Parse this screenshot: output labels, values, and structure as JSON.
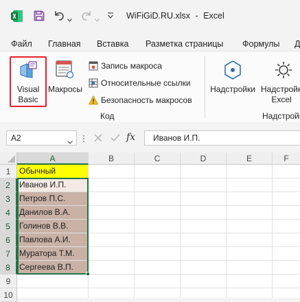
{
  "titlebar": {
    "file_name": "WiFiGiD.RU.xlsx",
    "separator": "-",
    "app_name": "Excel",
    "colors": {
      "excel_green": "#107c41",
      "save_purple": "#7b3fa0"
    }
  },
  "menu": {
    "items": [
      "Файл",
      "Главная",
      "Вставка",
      "Разметка страницы",
      "Формулы",
      "Д"
    ]
  },
  "ribbon": {
    "visual_basic_line1": "Visual",
    "visual_basic_line2": "Basic",
    "macros": "Макросы",
    "record_macro": "Запись макроса",
    "relative_refs": "Относительные ссылки",
    "macro_security": "Безопасность макросов",
    "group_code": "Код",
    "addins": "Надстройки",
    "excel_addins_line1": "Надстройки",
    "excel_addins_line2": "Excel",
    "group_addins": "Надстройки",
    "highlight_color": "#e8202a"
  },
  "formula_bar": {
    "name_box": "A2",
    "fx": "fx",
    "content": "Иванов И.П."
  },
  "sheet": {
    "columns": [
      "A",
      "B",
      "C",
      "D",
      "E",
      "F"
    ],
    "rows": [
      "1",
      "2",
      "3",
      "4",
      "5",
      "6",
      "7",
      "8",
      "9",
      "10"
    ],
    "header_cell": "Обычный",
    "names": [
      "Иванов И.П.",
      "Петров П.С.",
      "Данилов В.А.",
      "Голинов В.В.",
      "Павлова А.И.",
      "Муратора Т.М.",
      "Сергеева В.П."
    ],
    "colors": {
      "header_fill": "#ffff00",
      "name_fill": "#c9b1a6",
      "active_fill": "#f4e9e4",
      "selection_border": "#217346"
    }
  }
}
